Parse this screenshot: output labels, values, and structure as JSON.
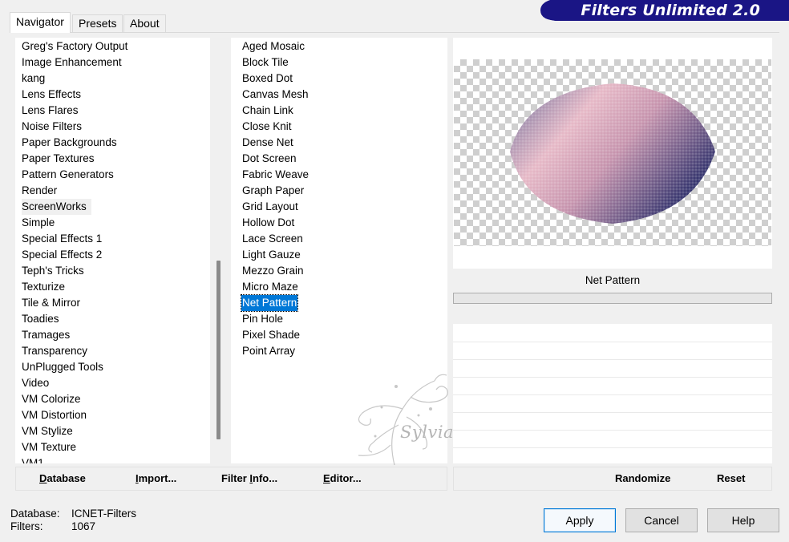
{
  "app": {
    "title": "Filters Unlimited 2.0",
    "accent_color": "#1a1585"
  },
  "tabs": [
    {
      "label": "Navigator",
      "active": true
    },
    {
      "label": "Presets",
      "active": false
    },
    {
      "label": "About",
      "active": false
    }
  ],
  "categories": {
    "items": [
      "Greg's Factory Output",
      "Image Enhancement",
      "kang",
      "Lens Effects",
      "Lens Flares",
      "Noise Filters",
      "Paper Backgrounds",
      "Paper Textures",
      "Pattern Generators",
      "Render",
      "ScreenWorks",
      "Simple",
      "Special Effects 1",
      "Special Effects 2",
      "Teph's Tricks",
      "Texturize",
      "Tile & Mirror",
      "Toadies",
      "Tramages",
      "Transparency",
      "UnPlugged Tools",
      "Video",
      "VM Colorize",
      "VM Distortion",
      "VM Stylize",
      "VM Texture",
      "VM1"
    ],
    "hovered": "ScreenWorks"
  },
  "filters": {
    "items": [
      "Aged Mosaic",
      "Block Tile",
      "Boxed Dot",
      "Canvas Mesh",
      "Chain Link",
      "Close Knit",
      "Dense Net",
      "Dot Screen",
      "Fabric Weave",
      "Graph Paper",
      "Grid Layout",
      "Hollow Dot",
      "Lace Screen",
      "Light Gauze",
      "Mezzo Grain",
      "Micro Maze",
      "Net Pattern",
      "Pin Hole",
      "Pixel Shade",
      "Point Array"
    ],
    "selected": "Net Pattern"
  },
  "preview": {
    "filter_name": "Net Pattern"
  },
  "toolbar_left": {
    "database": {
      "underlined": "D",
      "rest": "atabase"
    },
    "import": {
      "underlined": "I",
      "rest": "mport..."
    },
    "filter_info": {
      "prefix": "Filter ",
      "underlined": "I",
      "rest": "nfo..."
    },
    "editor": {
      "underlined": "E",
      "rest": "ditor..."
    }
  },
  "toolbar_right": {
    "randomize": "Randomize",
    "reset": "Reset"
  },
  "status": {
    "database_label": "Database:",
    "database_value": "ICNET-Filters",
    "filters_label": "Filters:",
    "filters_value": "1067"
  },
  "buttons": {
    "apply": "Apply",
    "cancel": "Cancel",
    "help": "Help"
  },
  "watermark": {
    "text": "Sylviane"
  }
}
